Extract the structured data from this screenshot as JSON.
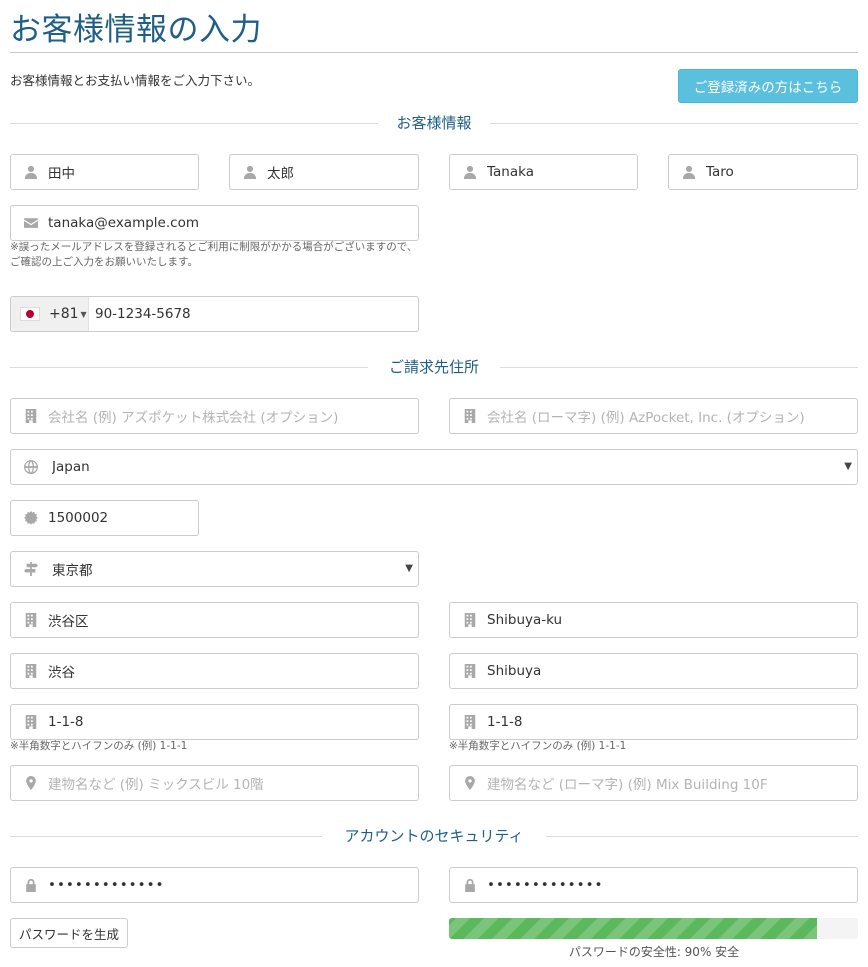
{
  "page": {
    "title": "お客様情報の入力"
  },
  "intro": {
    "text": "お客様情報とお支払い情報をご入力下さい。",
    "login_button": "ご登録済みの方はこちら"
  },
  "sections": {
    "customer": "お客様情報",
    "billing": "ご請求先住所",
    "security": "アカウントのセキュリティ"
  },
  "customer": {
    "last_name_kanji": "田中",
    "first_name_kanji": "太郎",
    "last_name_roman": "Tanaka",
    "first_name_roman": "Taro",
    "email": "tanaka@example.com",
    "email_note": "※誤ったメールアドレスを登録されるとご利用に制限がかかる場合がございますので、ご確認の上ご入力をお願いいたします。",
    "phone_code": "+81",
    "phone_number": "90-1234-5678"
  },
  "billing": {
    "company_placeholder": "会社名 (例) アズポケット株式会社 (オプション)",
    "company_roman_placeholder": "会社名 (ローマ字) (例) AzPocket, Inc. (オプション)",
    "country": "Japan",
    "postal_code": "1500002",
    "prefecture": "東京都",
    "city": "渋谷区",
    "city_roman": "Shibuya-ku",
    "town": "渋谷",
    "town_roman": "Shibuya",
    "street": "1-1-8",
    "street_roman": "1-1-8",
    "street_note": "※半角数字とハイフンのみ (例) 1-1-1",
    "street_roman_note": "※半角数字とハイフンのみ (例) 1-1-1",
    "building_placeholder": "建物名など (例) ミックスビル 10階",
    "building_roman_placeholder": "建物名など (ローマ字) (例) Mix Building 10F"
  },
  "security": {
    "password": "•••••••••••••",
    "password_confirm": "•••••••••••••",
    "generate_button": "パスワードを生成",
    "strength_fraction": 0.9,
    "strength_text": "パスワードの安全性: 90% 安全"
  },
  "colors": {
    "title": "#1f5f87",
    "login_button": "#5bc0de",
    "strength_bar": "#5cb85c",
    "flag_red": "#bc002d"
  },
  "icons": {
    "person": "person-icon",
    "email": "envelope-icon",
    "building": "building-icon",
    "globe": "globe-icon",
    "postal": "badge-icon",
    "signpost": "signpost-icon",
    "map_marker": "map-marker-icon",
    "lock": "lock-icon"
  }
}
